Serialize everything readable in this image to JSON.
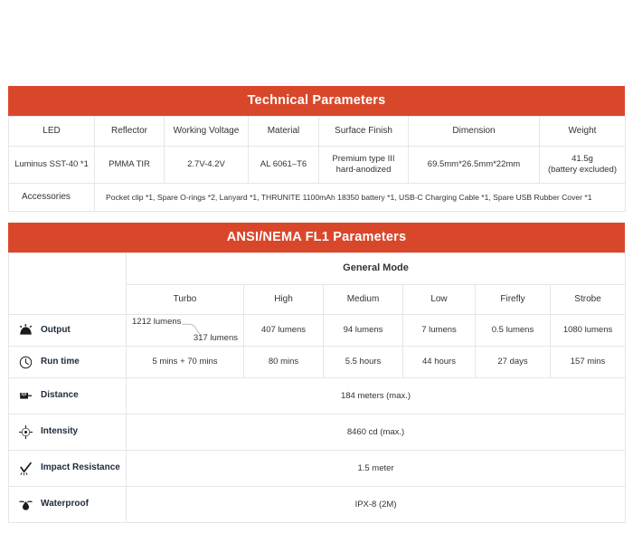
{
  "technical": {
    "banner_title": "Technical Parameters",
    "columns": [
      "LED",
      "Reflector",
      "Working Voltage",
      "Material",
      "Surface Finish",
      "Dimension",
      "Weight"
    ],
    "values": [
      {
        "text": "Luminus SST-40 *1"
      },
      {
        "text": "PMMA TIR"
      },
      {
        "text": "2.7V-4.2V"
      },
      {
        "text": "AL 6061–T6"
      },
      {
        "text": "Premium type III",
        "sub": "hard-anodized"
      },
      {
        "text": "69.5mm*26.5mm*22mm"
      },
      {
        "text": "41.5g",
        "sub": "(battery excluded)"
      }
    ],
    "accessories_label": "Accessories",
    "accessories_value": "Pocket clip *1, Spare O-rings *2, Lanyard *1, THRUNITE 1100mAh 18350 battery *1, USB-C Charging Cable *1, Spare USB Rubber Cover *1"
  },
  "ansi": {
    "banner_title": "ANSI/NEMA FL1 Parameters",
    "group_label": "General Mode",
    "modes": [
      "Turbo",
      "High",
      "Medium",
      "Low",
      "Firefly",
      "Strobe"
    ],
    "rows": [
      {
        "label": "Output",
        "icon": "beam-icon",
        "type": "per-mode",
        "turbo_primary": "1212  lumens",
        "turbo_stepdown": "317 lumens",
        "values": [
          "",
          "407 lumens",
          "94  lumens",
          "7 lumens",
          "0.5 lumens",
          "1080  lumens"
        ]
      },
      {
        "label": "Run time",
        "icon": "clock-icon",
        "type": "per-mode",
        "values": [
          "5 mins + 70  mins",
          "80 mins",
          "5.5 hours",
          "44 hours",
          "27 days",
          "157 mins"
        ]
      },
      {
        "label": "Distance",
        "icon": "ruler-icon",
        "type": "merged",
        "value": "184 meters (max.)"
      },
      {
        "label": "Intensity",
        "icon": "crosshair-icon",
        "type": "merged",
        "value": "8460 cd (max.)"
      },
      {
        "label": "Impact Resistance",
        "icon": "checkmark-impact-icon",
        "type": "merged",
        "value": "1.5 meter"
      },
      {
        "label": "Waterproof",
        "icon": "water-drop-icon",
        "type": "merged",
        "value": "IPX-8 (2M)"
      }
    ]
  },
  "colors": {
    "banner_red": "#d9472b",
    "border_gray": "#e6e6e6",
    "text_dark": "#333333",
    "label_dark": "#1c2b3a"
  }
}
